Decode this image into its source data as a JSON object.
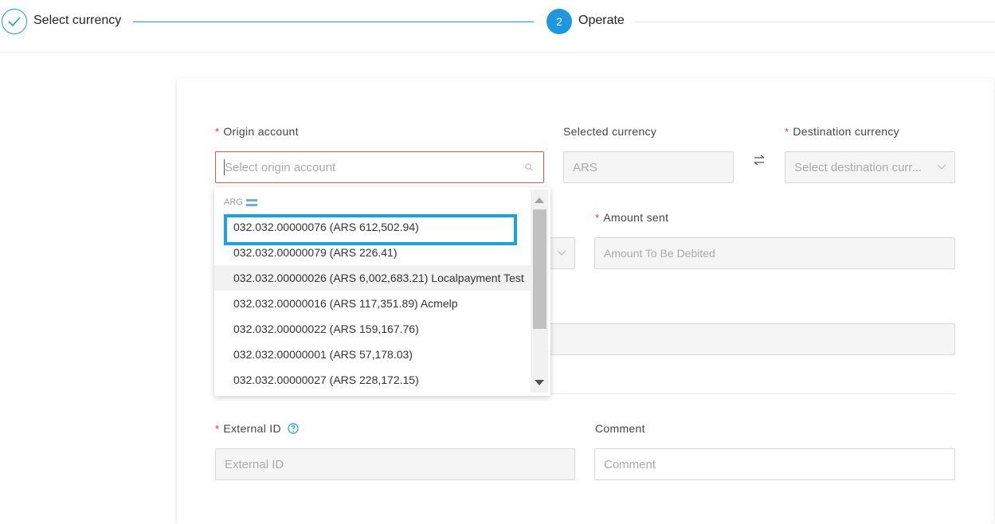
{
  "stepper": {
    "step1": {
      "label": "Select currency",
      "status": "completed"
    },
    "step2": {
      "number": "2",
      "label": "Operate",
      "status": "active"
    }
  },
  "form": {
    "origin_account": {
      "required_mark": "*",
      "label": "Origin account",
      "placeholder": "Select origin account"
    },
    "selected_currency": {
      "label": "Selected currency",
      "value": "ARS"
    },
    "destination_currency": {
      "required_mark": "*",
      "label": "Destination currency",
      "placeholder": "Select destination curr..."
    },
    "amount_sent": {
      "required_mark": "*",
      "label": "Amount sent",
      "placeholder": "Amount To Be Debited"
    },
    "external_id": {
      "required_mark": "*",
      "label": "External ID",
      "placeholder": "External ID"
    },
    "comment": {
      "label": "Comment",
      "placeholder": "Comment"
    }
  },
  "dropdown": {
    "group": "ARG",
    "options": [
      "032.032.00000076 (ARS 612,502.94)",
      "032.032.00000079 (ARS 226.41)",
      "032.032.00000026 (ARS 6,002,683.21) Localpayment Test",
      "032.032.00000016 (ARS 117,351.89) Acmelp",
      "032.032.00000022 (ARS 159,167.76)",
      "032.032.00000001 (ARS 57,178.03)",
      "032.032.00000027 (ARS 228,172.15)"
    ]
  },
  "colors": {
    "accent": "#1e96e0",
    "error": "#e05555",
    "highlight": "#1aa3e0"
  }
}
